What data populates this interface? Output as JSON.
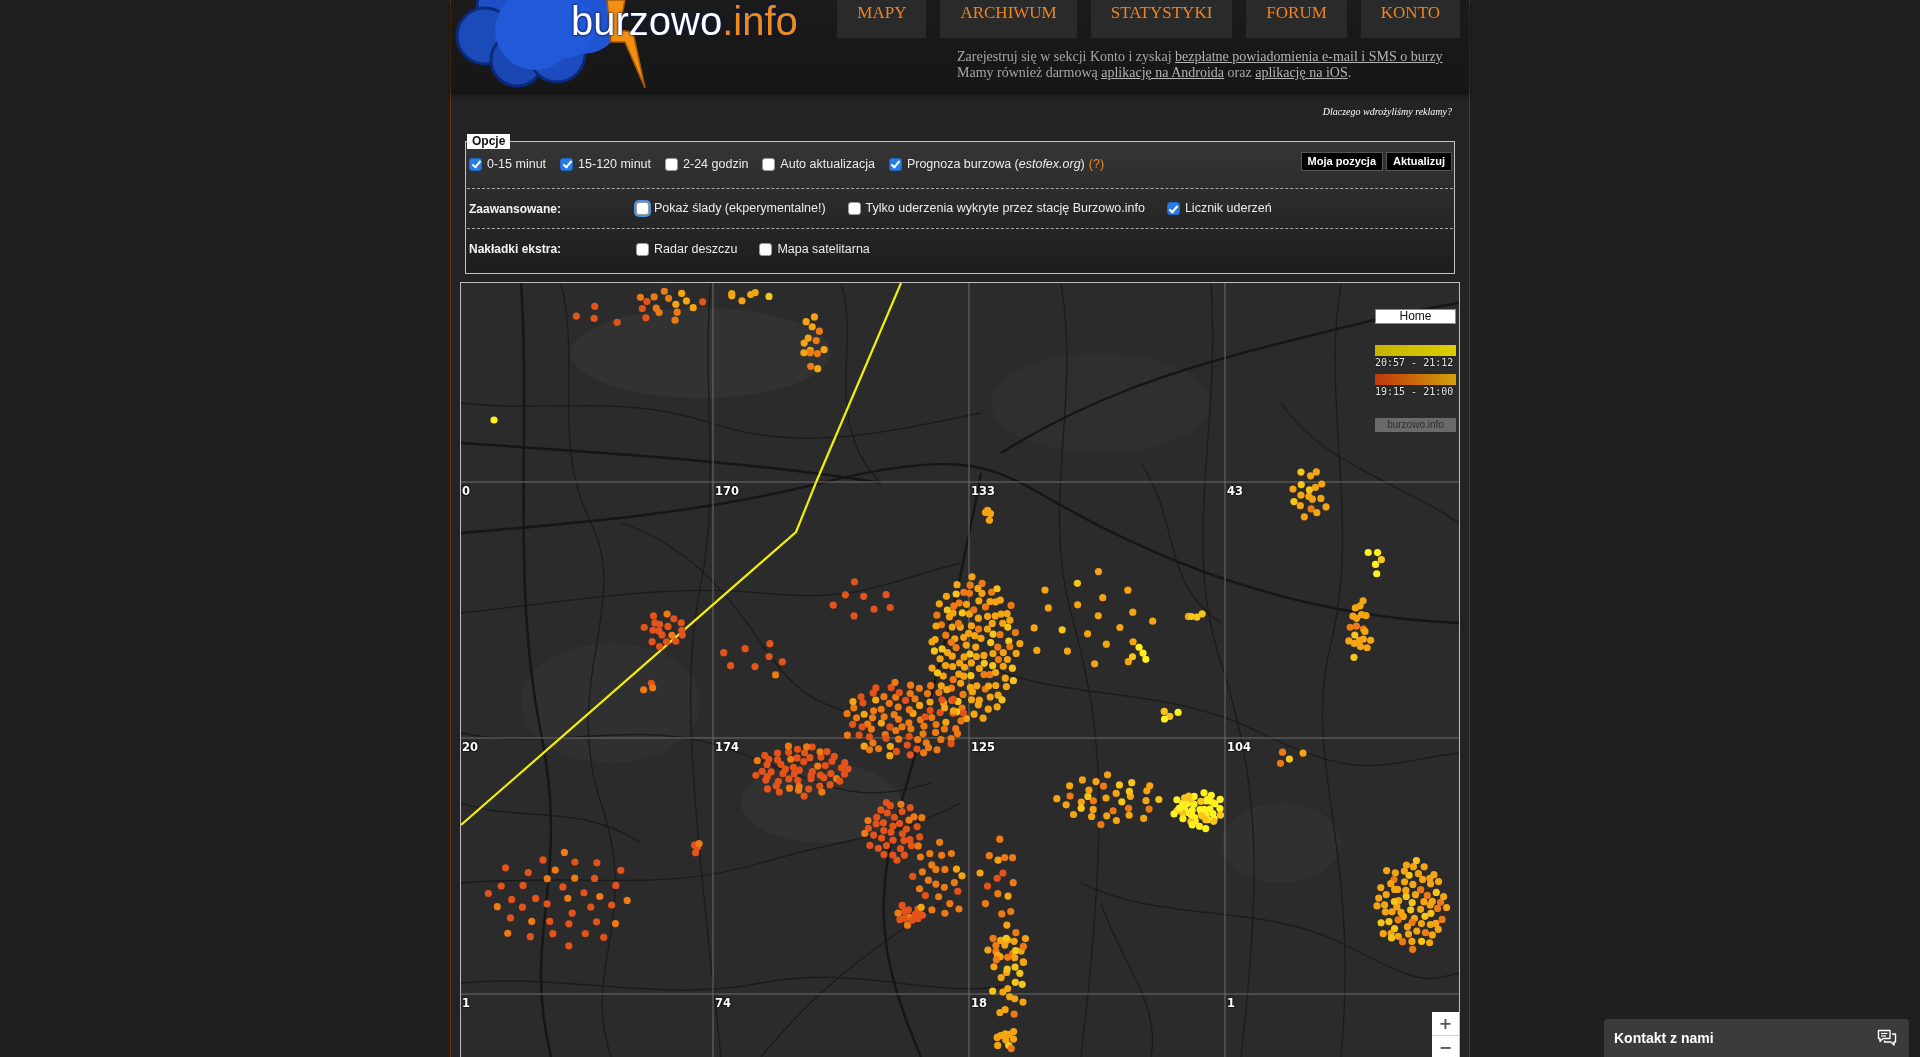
{
  "header": {
    "logo": {
      "name": "burzowo",
      "suffix": ".info"
    },
    "nav": [
      {
        "label": "MAPY"
      },
      {
        "label": "ARCHIWUM"
      },
      {
        "label": "STATYSTYKI"
      },
      {
        "label": "FORUM"
      },
      {
        "label": "KONTO"
      }
    ],
    "promo": [
      [
        {
          "text": "Zarejestruj się w sekcji Konto i zyskaj ",
          "kind": "text"
        },
        {
          "text": "bezpłatne powiadomienia e-mail i SMS o burzy",
          "kind": "link"
        }
      ],
      [
        {
          "text": "Mamy również darmową ",
          "kind": "text"
        },
        {
          "text": "aplikację na Androida",
          "kind": "link"
        },
        {
          "text": " oraz ",
          "kind": "text"
        },
        {
          "text": "aplikację na iOS",
          "kind": "link"
        },
        {
          "text": ".",
          "kind": "text"
        }
      ]
    ],
    "ads_link": "Dlaczego wdrożyliśmy reklamy?"
  },
  "options": {
    "title": "Opcje",
    "time_filters": [
      {
        "label": "0-15 minut",
        "checked": true,
        "focused": false
      },
      {
        "label": "15-120 minut",
        "checked": true,
        "focused": false
      },
      {
        "label": "2-24 godzin",
        "checked": false,
        "focused": false
      },
      {
        "label": "Auto aktualizacja",
        "checked": false,
        "focused": false
      },
      {
        "label": "Prognoza burzowa (*estofex.org*)",
        "checked": true,
        "focused": false
      }
    ],
    "help_link": "(?)",
    "buttons": [
      "Moja pozycja",
      "Aktualizuj"
    ],
    "sections": [
      {
        "label": "Zaawansowane:",
        "checkboxes": [
          {
            "label": "Pokaż ślady (ekperymentalne!)",
            "checked": false,
            "focused": true
          },
          {
            "label": "Tylko uderzenia wykryte przez stację Burzowo.info",
            "checked": false,
            "focused": false
          },
          {
            "label": "Licznik uderzeń",
            "checked": true,
            "focused": false
          }
        ]
      },
      {
        "label": "Nakładki ekstra:",
        "checkboxes": [
          {
            "label": "Radar deszczu",
            "checked": false,
            "focused": false
          },
          {
            "label": "Mapa satelitarna",
            "checked": false,
            "focused": false
          }
        ]
      }
    ]
  },
  "map": {
    "strike_counts": [
      [
        "0",
        "170",
        "133",
        "43"
      ],
      [
        "20",
        "174",
        "125",
        "104"
      ],
      [
        "1",
        "74",
        "18",
        "1"
      ]
    ],
    "home_button": "Home",
    "legend": [
      {
        "kind": "recent",
        "label": "20:57 - 21:12"
      },
      {
        "kind": "older",
        "label": "19:15 - 21:00"
      }
    ],
    "attribution": "burzowo.info",
    "zoom": [
      "+",
      "−"
    ]
  },
  "contact": {
    "label": "Kontakt z nami"
  }
}
